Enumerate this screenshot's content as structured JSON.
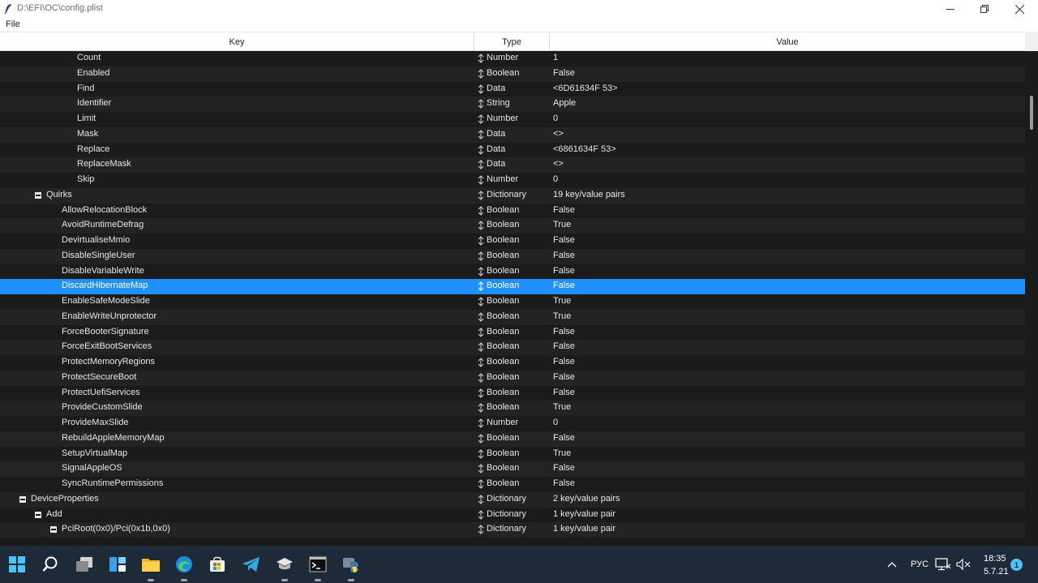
{
  "window": {
    "title": "D:\\EFI\\OC\\config.plist",
    "menu_file": "File"
  },
  "columns": {
    "key": "Key",
    "type": "Type",
    "value": "Value"
  },
  "rows": [
    {
      "key": "Count",
      "type": "Number",
      "value": "1",
      "depth": 5
    },
    {
      "key": "Enabled",
      "type": "Boolean",
      "value": "False",
      "depth": 5
    },
    {
      "key": "Find",
      "type": "Data",
      "value": "<6D61634F 53>",
      "depth": 5
    },
    {
      "key": "Identifier",
      "type": "String",
      "value": "Apple",
      "depth": 5
    },
    {
      "key": "Limit",
      "type": "Number",
      "value": "0",
      "depth": 5
    },
    {
      "key": "Mask",
      "type": "Data",
      "value": "<>",
      "depth": 5
    },
    {
      "key": "Replace",
      "type": "Data",
      "value": "<6861634F 53>",
      "depth": 5
    },
    {
      "key": "ReplaceMask",
      "type": "Data",
      "value": "<>",
      "depth": 5
    },
    {
      "key": "Skip",
      "type": "Number",
      "value": "0",
      "depth": 5
    },
    {
      "key": "Quirks",
      "type": "Dictionary",
      "value": "19 key/value pairs",
      "depth": 2,
      "expandable": true
    },
    {
      "key": "AllowRelocationBlock",
      "type": "Boolean",
      "value": "False",
      "depth": 4
    },
    {
      "key": "AvoidRuntimeDefrag",
      "type": "Boolean",
      "value": "True",
      "depth": 4
    },
    {
      "key": "DevirtualiseMmio",
      "type": "Boolean",
      "value": "False",
      "depth": 4
    },
    {
      "key": "DisableSingleUser",
      "type": "Boolean",
      "value": "False",
      "depth": 4
    },
    {
      "key": "DisableVariableWrite",
      "type": "Boolean",
      "value": "False",
      "depth": 4
    },
    {
      "key": "DiscardHibernateMap",
      "type": "Boolean",
      "value": "False",
      "depth": 4,
      "selected": true
    },
    {
      "key": "EnableSafeModeSlide",
      "type": "Boolean",
      "value": "True",
      "depth": 4
    },
    {
      "key": "EnableWriteUnprotector",
      "type": "Boolean",
      "value": "True",
      "depth": 4
    },
    {
      "key": "ForceBooterSignature",
      "type": "Boolean",
      "value": "False",
      "depth": 4
    },
    {
      "key": "ForceExitBootServices",
      "type": "Boolean",
      "value": "False",
      "depth": 4
    },
    {
      "key": "ProtectMemoryRegions",
      "type": "Boolean",
      "value": "False",
      "depth": 4
    },
    {
      "key": "ProtectSecureBoot",
      "type": "Boolean",
      "value": "False",
      "depth": 4
    },
    {
      "key": "ProtectUefiServices",
      "type": "Boolean",
      "value": "False",
      "depth": 4
    },
    {
      "key": "ProvideCustomSlide",
      "type": "Boolean",
      "value": "True",
      "depth": 4
    },
    {
      "key": "ProvideMaxSlide",
      "type": "Number",
      "value": "0",
      "depth": 4
    },
    {
      "key": "RebuildAppleMemoryMap",
      "type": "Boolean",
      "value": "False",
      "depth": 4
    },
    {
      "key": "SetupVirtualMap",
      "type": "Boolean",
      "value": "True",
      "depth": 4
    },
    {
      "key": "SignalAppleOS",
      "type": "Boolean",
      "value": "False",
      "depth": 4
    },
    {
      "key": "SyncRuntimePermissions",
      "type": "Boolean",
      "value": "False",
      "depth": 4
    },
    {
      "key": "DeviceProperties",
      "type": "Dictionary",
      "value": "2 key/value pairs",
      "depth": 1,
      "expandable": true
    },
    {
      "key": "Add",
      "type": "Dictionary",
      "value": "1 key/value pair",
      "depth": 2,
      "expandable": true
    },
    {
      "key": "PciRoot(0x0)/Pci(0x1b,0x0)",
      "type": "Dictionary",
      "value": "1 key/value pair",
      "depth": 3,
      "expandable": true
    }
  ],
  "taskbar": {
    "apps": [
      "windows-start-icon",
      "search-icon",
      "task-view-icon",
      "widgets-icon",
      "file-explorer-icon",
      "edge-icon",
      "store-icon",
      "telegram-icon",
      "installer-icon",
      "terminal-icon",
      "python-icon"
    ],
    "language": "РУС",
    "time": "18:35",
    "date": "5.7.21",
    "notifications": "1"
  },
  "colors": {
    "selection": "#1e90ff",
    "background": "#1b1b1b",
    "taskbar": "#1f2a38"
  }
}
